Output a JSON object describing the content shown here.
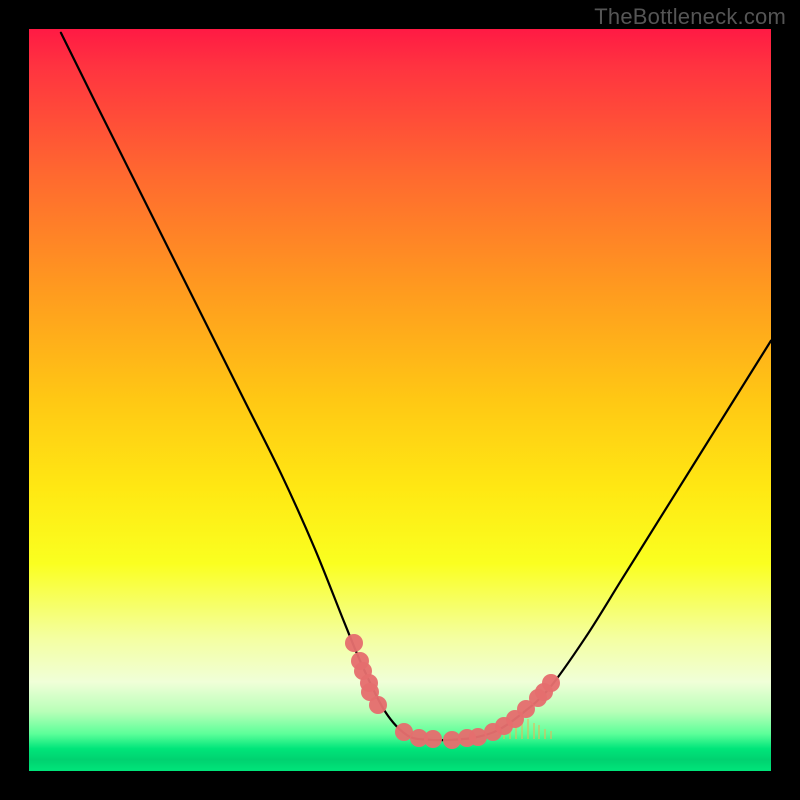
{
  "watermark": "TheBottleneck.com",
  "chart_data": {
    "type": "line",
    "title": "",
    "xlabel": "",
    "ylabel": "",
    "xlim": [
      0,
      100
    ],
    "ylim": [
      0,
      100
    ],
    "curve": [
      {
        "x": 4.3,
        "y": 99.5
      },
      {
        "x": 9,
        "y": 90
      },
      {
        "x": 14,
        "y": 80
      },
      {
        "x": 19,
        "y": 70
      },
      {
        "x": 24,
        "y": 60
      },
      {
        "x": 29,
        "y": 50
      },
      {
        "x": 34,
        "y": 40
      },
      {
        "x": 38.5,
        "y": 30
      },
      {
        "x": 42.5,
        "y": 20
      },
      {
        "x": 45,
        "y": 14
      },
      {
        "x": 48,
        "y": 8
      },
      {
        "x": 51,
        "y": 4.8
      },
      {
        "x": 54,
        "y": 4.2
      },
      {
        "x": 57,
        "y": 4.2
      },
      {
        "x": 60,
        "y": 4.5
      },
      {
        "x": 63,
        "y": 5.4
      },
      {
        "x": 66,
        "y": 7.4
      },
      {
        "x": 70,
        "y": 11
      },
      {
        "x": 75,
        "y": 18
      },
      {
        "x": 80,
        "y": 26
      },
      {
        "x": 85,
        "y": 34
      },
      {
        "x": 90,
        "y": 42
      },
      {
        "x": 95,
        "y": 50
      },
      {
        "x": 100,
        "y": 58
      }
    ],
    "markers": [
      {
        "x": 43.8,
        "y": 17.2
      },
      {
        "x": 44.6,
        "y": 14.8
      },
      {
        "x": 45.0,
        "y": 13.5
      },
      {
        "x": 45.8,
        "y": 11.8
      },
      {
        "x": 46.0,
        "y": 10.7
      },
      {
        "x": 47.0,
        "y": 8.9
      },
      {
        "x": 50.5,
        "y": 5.2
      },
      {
        "x": 52.5,
        "y": 4.5
      },
      {
        "x": 54.5,
        "y": 4.3
      },
      {
        "x": 57.0,
        "y": 4.2
      },
      {
        "x": 59.0,
        "y": 4.4
      },
      {
        "x": 60.5,
        "y": 4.6
      },
      {
        "x": 62.5,
        "y": 5.2
      },
      {
        "x": 64.0,
        "y": 6.0
      },
      {
        "x": 65.5,
        "y": 7.0
      },
      {
        "x": 67.0,
        "y": 8.3
      },
      {
        "x": 68.6,
        "y": 9.9
      },
      {
        "x": 69.4,
        "y": 10.6
      },
      {
        "x": 70.4,
        "y": 11.8
      }
    ],
    "ticks": [
      {
        "x": 64.0,
        "h": 4
      },
      {
        "x": 64.8,
        "h": 6
      },
      {
        "x": 65.6,
        "h": 8
      },
      {
        "x": 66.4,
        "h": 14
      },
      {
        "x": 67.2,
        "h": 10
      },
      {
        "x": 68.0,
        "h": 8
      },
      {
        "x": 68.8,
        "h": 7
      },
      {
        "x": 69.6,
        "h": 5
      },
      {
        "x": 70.4,
        "h": 4
      }
    ],
    "colors": {
      "marker": "#e56e6e",
      "curve": "#000000"
    }
  }
}
